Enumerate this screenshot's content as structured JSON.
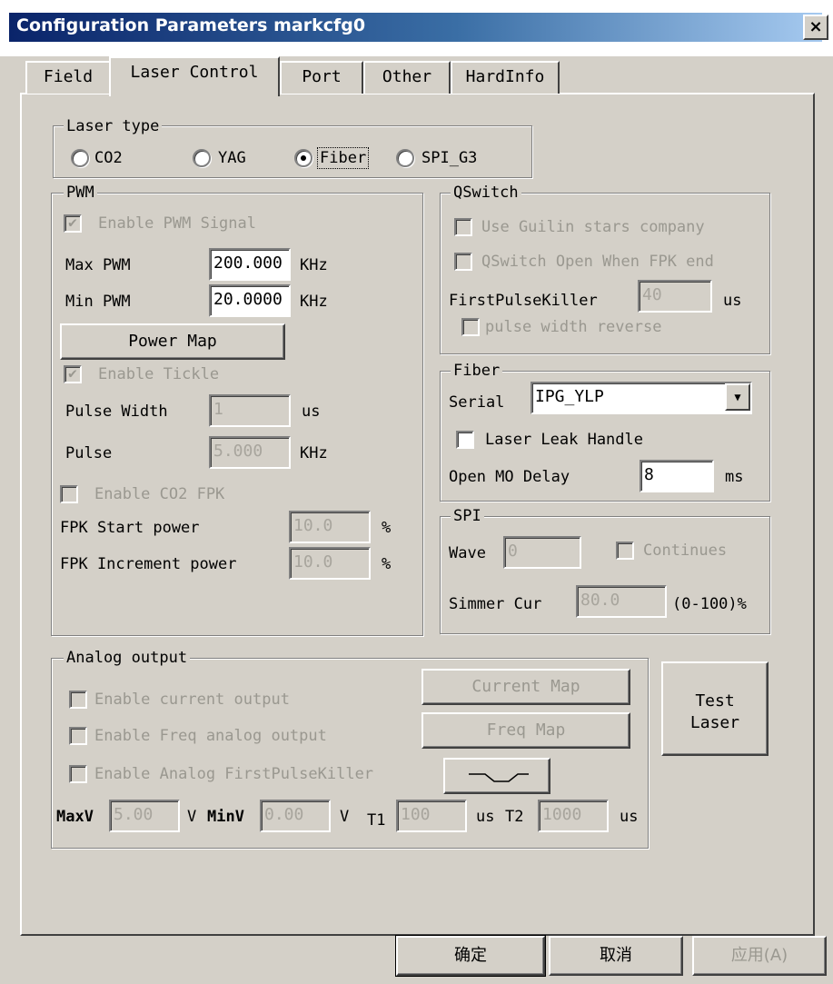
{
  "window": {
    "title": "Configuration Parameters markcfg0",
    "close_label": "×"
  },
  "tabs": [
    {
      "label": "Field",
      "active": false
    },
    {
      "label": "Laser Control",
      "active": true
    },
    {
      "label": "Port",
      "active": false
    },
    {
      "label": "Other",
      "active": false
    },
    {
      "label": "HardInfo",
      "active": false
    }
  ],
  "laser_type": {
    "legend": "Laser type",
    "options": [
      "CO2",
      "YAG",
      "Fiber",
      "SPI_G3"
    ],
    "selected": "Fiber"
  },
  "pwm": {
    "legend": "PWM",
    "enable_pwm_signal": "Enable PWM Signal",
    "max_pwm_label": "Max PWM",
    "max_pwm_value": "200.000",
    "max_pwm_unit": "KHz",
    "min_pwm_label": "Min PWM",
    "min_pwm_value": "20.0000",
    "min_pwm_unit": "KHz",
    "power_map_button": "Power Map",
    "enable_tickle": "Enable Tickle",
    "pulse_width_label": "Pulse Width",
    "pulse_width_value": "1",
    "pulse_width_unit": "us",
    "pulse_label": "Pulse",
    "pulse_value": "5.000",
    "pulse_unit": "KHz",
    "enable_co2_fpk": "Enable CO2 FPK",
    "fpk_start_label": "FPK Start power",
    "fpk_start_value": "10.0",
    "fpk_start_unit": "%",
    "fpk_inc_label": "FPK Increment power",
    "fpk_inc_value": "10.0",
    "fpk_inc_unit": "%"
  },
  "qswitch": {
    "legend": "QSwitch",
    "use_guilin": "Use Guilin stars company",
    "qswitch_open": "QSwitch Open When FPK end",
    "fpk_label": "FirstPulseKiller",
    "fpk_value": "40",
    "fpk_unit": "us",
    "pulse_reverse": "pulse width reverse"
  },
  "fiber": {
    "legend": "Fiber",
    "serial_label": "Serial",
    "serial_value": "IPG_YLP",
    "laser_leak": "Laser Leak Handle",
    "open_mo_label": "Open MO Delay",
    "open_mo_value": "8",
    "open_mo_unit": "ms"
  },
  "spi": {
    "legend": "SPI",
    "wave_label": "Wave",
    "wave_value": "0",
    "continues": "Continues",
    "simmer_label": "Simmer Cur",
    "simmer_value": "80.0",
    "simmer_unit": "(0-100)%"
  },
  "analog": {
    "legend": "Analog output",
    "enable_current": "Enable current output",
    "enable_freq": "Enable Freq analog output",
    "enable_fpk": "Enable Analog FirstPulseKiller",
    "current_map_button": "Current Map",
    "freq_map_button": "Freq Map",
    "maxv_label": "MaxV",
    "maxv_value": "5.00",
    "maxv_unit": "V",
    "minv_label": "MinV",
    "minv_value": "0.00",
    "minv_unit": "V",
    "t1_label": "T1",
    "t1_value": "100",
    "t1_unit": "us",
    "t2_label": "T2",
    "t2_value": "1000",
    "t2_unit": "us"
  },
  "test_laser_button": [
    "Test",
    "Laser"
  ],
  "footer": {
    "ok": "确定",
    "cancel": "取消",
    "apply": "应用(A)"
  },
  "colors": {
    "face": "#d4d0c8",
    "title_start": "#0a246a",
    "title_end": "#a6caf0",
    "disabled_text": "#9a9890"
  }
}
